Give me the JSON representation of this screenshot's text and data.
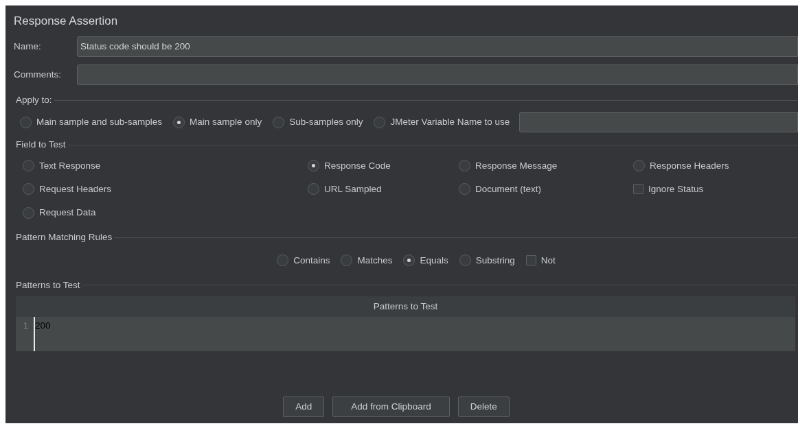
{
  "window": {
    "title": "Response Assertion"
  },
  "name_field": {
    "label": "Name:",
    "value": "Status code should be 200"
  },
  "comments_field": {
    "label": "Comments:"
  },
  "apply_to": {
    "legend": "Apply to:",
    "options": [
      {
        "label": "Main sample and sub-samples",
        "selected": false
      },
      {
        "label": "Main sample only",
        "selected": true
      },
      {
        "label": "Sub-samples only",
        "selected": false
      },
      {
        "label": "JMeter Variable Name to use",
        "selected": false
      }
    ]
  },
  "field_to_test": {
    "legend": "Field to Test",
    "items": [
      {
        "kind": "radio",
        "label": "Text Response",
        "selected": false
      },
      {
        "kind": "radio",
        "label": "Response Code",
        "selected": true
      },
      {
        "kind": "radio",
        "label": "Response Message",
        "selected": false
      },
      {
        "kind": "radio",
        "label": "Response Headers",
        "selected": false
      },
      {
        "kind": "radio",
        "label": "Request Headers",
        "selected": false
      },
      {
        "kind": "radio",
        "label": "URL Sampled",
        "selected": false
      },
      {
        "kind": "radio",
        "label": "Document (text)",
        "selected": false
      },
      {
        "kind": "checkbox",
        "label": "Ignore Status",
        "checked": false
      },
      {
        "kind": "radio",
        "label": "Request Data",
        "selected": false
      }
    ]
  },
  "pattern_matching_rules": {
    "legend": "Pattern Matching Rules",
    "items": [
      {
        "kind": "radio",
        "label": "Contains",
        "selected": false
      },
      {
        "kind": "radio",
        "label": "Matches",
        "selected": false
      },
      {
        "kind": "radio",
        "label": "Equals",
        "selected": true
      },
      {
        "kind": "radio",
        "label": "Substring",
        "selected": false
      },
      {
        "kind": "checkbox",
        "label": "Not",
        "checked": false
      }
    ]
  },
  "patterns_to_test": {
    "legend": "Patterns to Test",
    "table": {
      "columns": [
        "Patterns to Test"
      ],
      "rows": [
        {
          "line": "1",
          "value": "200"
        }
      ]
    }
  },
  "buttons": [
    "Add",
    "Add from Clipboard",
    "Delete"
  ]
}
